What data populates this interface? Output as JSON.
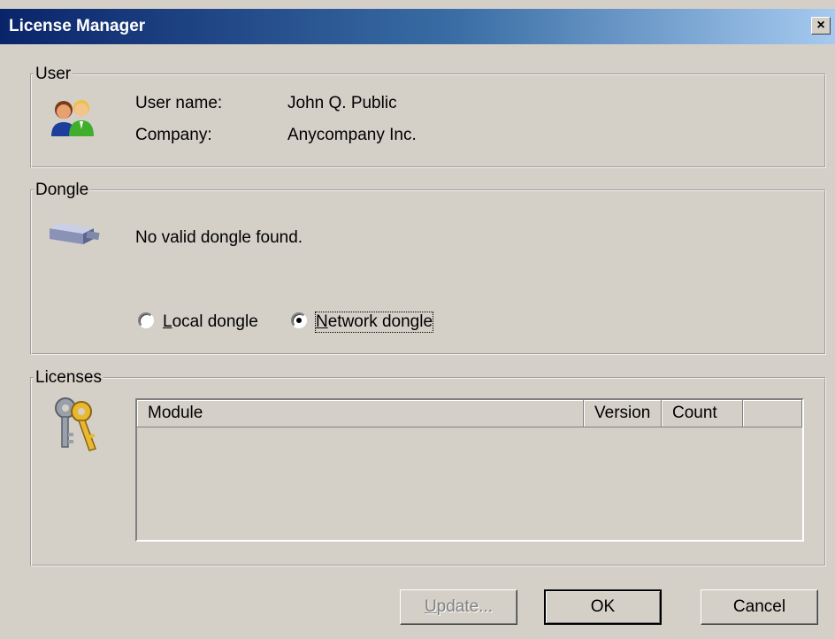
{
  "window": {
    "title": "License Manager",
    "close_label": "×"
  },
  "user_group": {
    "legend": "User",
    "icon": "users-icon",
    "username_label": "User name:",
    "username_value": "John Q. Public",
    "company_label": "Company:",
    "company_value": "Anycompany Inc."
  },
  "dongle_group": {
    "legend": "Dongle",
    "icon": "usb-dongle-icon",
    "status": "No valid dongle found.",
    "options": [
      {
        "mnemonic": "L",
        "rest": "ocal dongle",
        "selected": false
      },
      {
        "mnemonic": "N",
        "rest": "etwork dongle",
        "selected": true
      }
    ]
  },
  "licenses_group": {
    "legend": "Licenses",
    "icon": "keys-icon",
    "columns": [
      "Module",
      "Version",
      "Count",
      ""
    ],
    "rows": []
  },
  "buttons": {
    "update_mnemonic": "U",
    "update_rest": "pdate...",
    "update_enabled": false,
    "ok": "OK",
    "cancel": "Cancel"
  },
  "colors": {
    "face": "#d4d0c8",
    "title_start": "#0a246a",
    "title_end": "#a6caf0"
  }
}
